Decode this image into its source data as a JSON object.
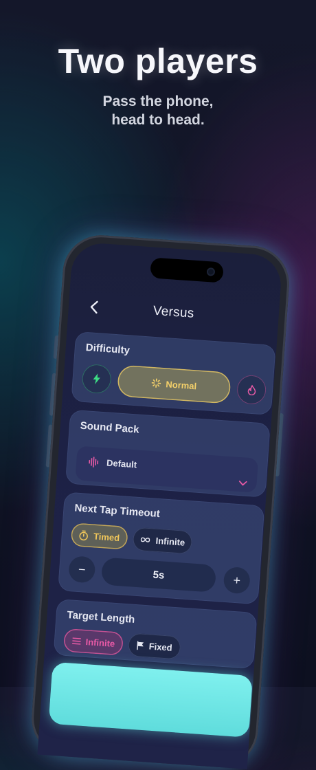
{
  "hero": {
    "title": "Two players",
    "subtitle_line1": "Pass the phone,",
    "subtitle_line2": "head to head."
  },
  "screen": {
    "title": "Versus",
    "back_icon": "chevron-left-icon"
  },
  "difficulty": {
    "title": "Difficulty",
    "easy_icon": "lightning-icon",
    "selected_label": "Normal",
    "selected_icon": "sparkle-icon",
    "hard_icon": "flame-icon"
  },
  "sound_pack": {
    "title": "Sound Pack",
    "value": "Default",
    "icon": "waveform-icon",
    "chevron_icon": "chevron-down-icon"
  },
  "timeout": {
    "title": "Next Tap Timeout",
    "option_timed": "Timed",
    "option_infinite": "Infinite",
    "minus_label": "−",
    "value": "5s",
    "plus_label": "+"
  },
  "target_length": {
    "title": "Target Length",
    "option_infinite": "Infinite",
    "option_fixed": "Fixed"
  },
  "colors": {
    "accent_yellow": "#f4d06a",
    "accent_pink": "#e85aa6",
    "accent_green": "#3ddc84",
    "accent_cyan": "#7ff0ee"
  }
}
